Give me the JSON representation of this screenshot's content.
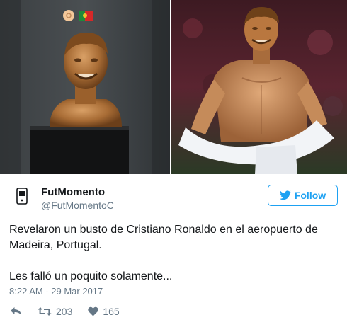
{
  "tweet": {
    "author_name": "FutMomento",
    "author_handle": "@FutMomentoC",
    "avatar_text": "FutMomento",
    "follow_label": "Follow",
    "text_line1": "Revelaron un busto de Cristiano Ronaldo en el aeropuerto de Madeira, Portugal.",
    "text_line2": "Les falló un poquito solamente...",
    "timestamp": "8:22 AM - 29 Mar 2017",
    "retweet_count": "203",
    "like_count": "165"
  },
  "icons": {
    "reply": "reply-icon",
    "retweet": "retweet-icon",
    "like": "heart-icon",
    "bird": "twitter-bird-icon"
  },
  "colors": {
    "accent": "#1da1f2",
    "secondary_text": "#657786",
    "primary_text": "#14171a"
  }
}
